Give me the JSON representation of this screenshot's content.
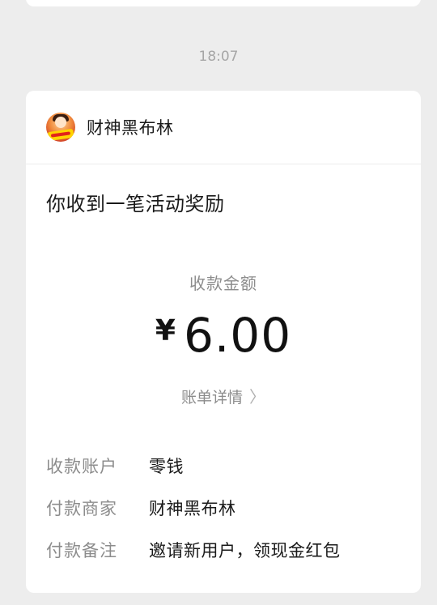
{
  "timestamp": "18:07",
  "card": {
    "merchant_name": "财神黑布林",
    "title": "你收到一笔活动奖励",
    "amount_label": "收款金额",
    "currency": "¥",
    "amount": "6.00",
    "bill_detail_link": "账单详情",
    "chevron_glyph": "〉",
    "details": [
      {
        "label": "收款账户",
        "value": "零钱"
      },
      {
        "label": "付款商家",
        "value": "财神黑布林"
      },
      {
        "label": "付款备注",
        "value": "邀请新用户，领现金红包"
      }
    ]
  }
}
